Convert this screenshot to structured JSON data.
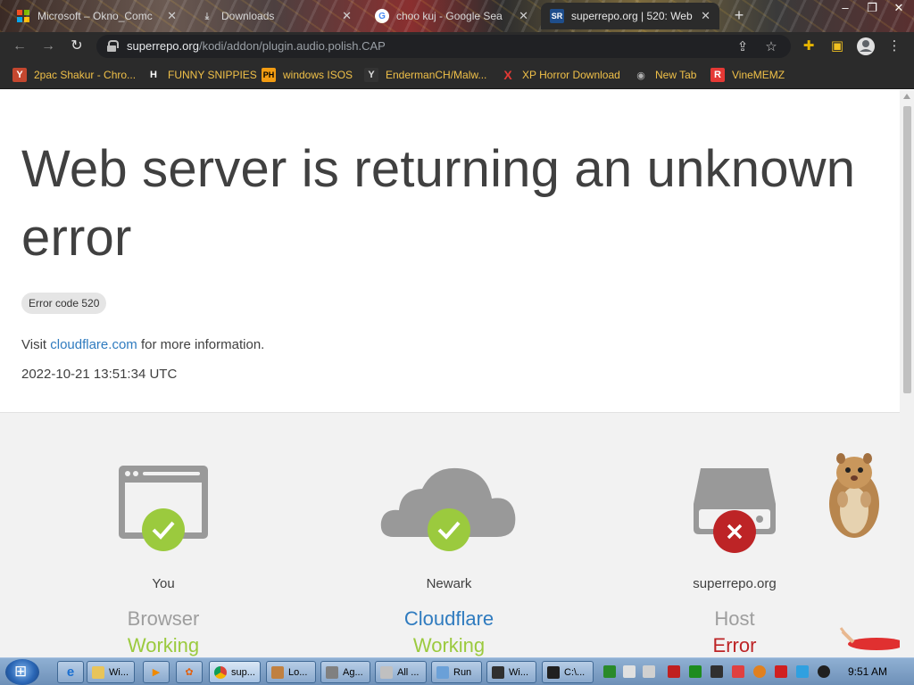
{
  "browser": {
    "tabs": [
      {
        "title": "Microsoft – Okno_Comc",
        "active": false
      },
      {
        "title": "Downloads",
        "active": false
      },
      {
        "title": "choo kuj - Google Sea",
        "active": false
      },
      {
        "title": "superrepo.org | 520: Web",
        "active": true
      }
    ],
    "url_host": "superrepo.org",
    "url_path": "/kodi/addon/plugin.audio.polish.CAP",
    "bookmarks": [
      {
        "label": "2pac Shakur - Chro...",
        "icon": "Y",
        "color": "#e0a020"
      },
      {
        "label": "FUNNY SNIPPIES",
        "icon": "H",
        "color": "#ffffff"
      },
      {
        "label": "windows ISOS",
        "icon": "PH",
        "color": "#f39c12"
      },
      {
        "label": "EndermanCH/Malw...",
        "icon": "Y",
        "color": "#d8d8d8"
      },
      {
        "label": "XP Horror Download",
        "icon": "X",
        "color": "#e53935"
      },
      {
        "label": "New Tab",
        "icon": "◉",
        "color": "#b0b0b0"
      },
      {
        "label": "VineMEMZ",
        "icon": "R",
        "color": "#e53935"
      }
    ]
  },
  "page": {
    "headline": "Web server is returning an unknown error",
    "error_code": "Error code 520",
    "visit_prefix": "Visit ",
    "visit_link": "cloudflare.com",
    "visit_suffix": " for more information.",
    "timestamp": "2022-10-21 13:51:34 UTC",
    "nodes": [
      {
        "location": "You",
        "role": "Browser",
        "status": "Working",
        "ok": true
      },
      {
        "location": "Newark",
        "role": "Cloudflare",
        "status": "Working",
        "ok": true
      },
      {
        "location": "superrepo.org",
        "role": "Host",
        "status": "Error",
        "ok": false
      }
    ],
    "colors": {
      "ok": "#9bca3e",
      "error": "#bd2426",
      "link": "#2f7bbf"
    }
  },
  "taskbar": {
    "buttons": [
      {
        "label": "Wi...",
        "color": "#e8c45a"
      },
      {
        "label": "sup...",
        "color": "#4aa3df"
      },
      {
        "label": "Lo...",
        "color": "#c08040"
      },
      {
        "label": "Ag...",
        "color": "#808080"
      },
      {
        "label": "All ...",
        "color": "#c0c0c0"
      },
      {
        "label": "Run",
        "color": "#6aa0d8"
      },
      {
        "label": "Wi...",
        "color": "#303030"
      },
      {
        "label": "C:\\...",
        "color": "#202020"
      }
    ],
    "clock": "9:51 AM"
  }
}
